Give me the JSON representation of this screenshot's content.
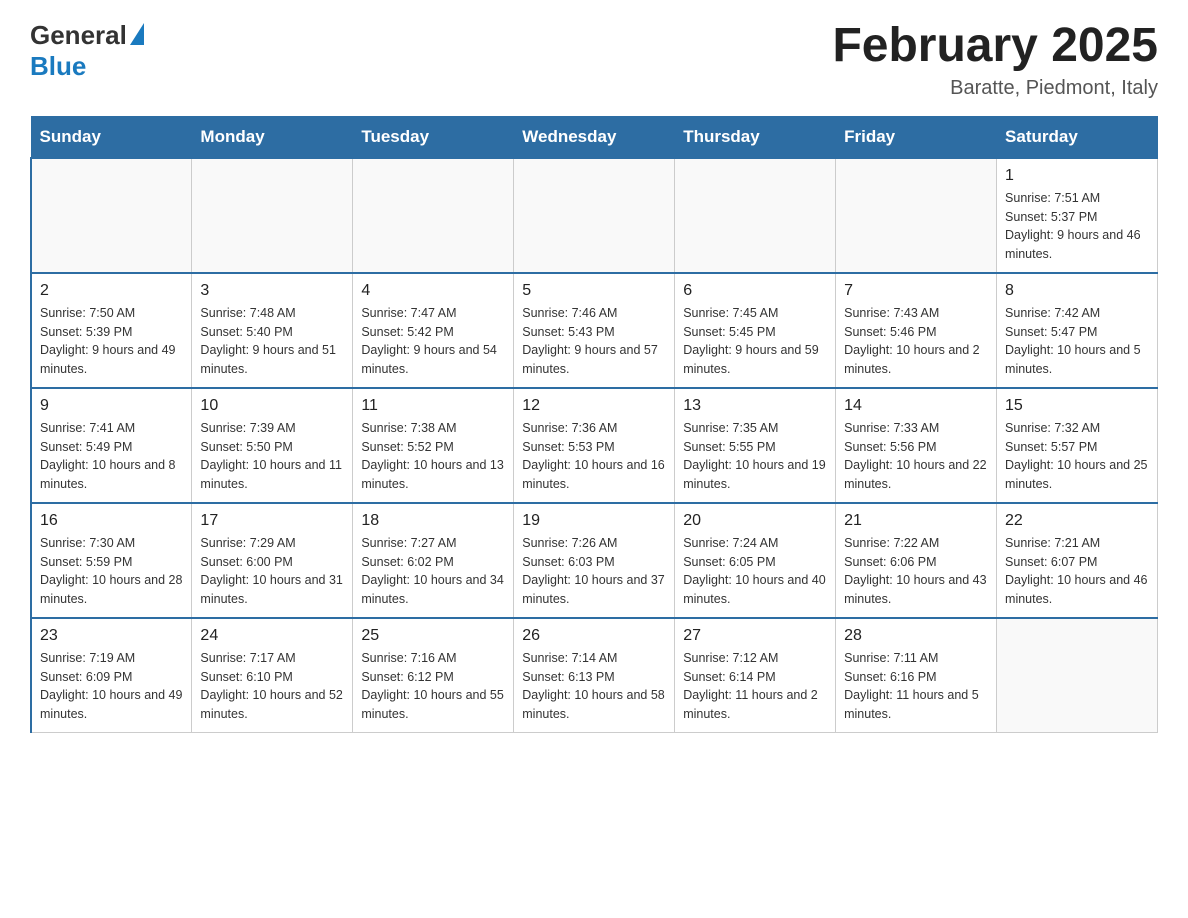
{
  "logo": {
    "general": "General",
    "blue": "Blue"
  },
  "header": {
    "title": "February 2025",
    "location": "Baratte, Piedmont, Italy"
  },
  "weekdays": [
    "Sunday",
    "Monday",
    "Tuesday",
    "Wednesday",
    "Thursday",
    "Friday",
    "Saturday"
  ],
  "weeks": [
    [
      {
        "day": "",
        "info": ""
      },
      {
        "day": "",
        "info": ""
      },
      {
        "day": "",
        "info": ""
      },
      {
        "day": "",
        "info": ""
      },
      {
        "day": "",
        "info": ""
      },
      {
        "day": "",
        "info": ""
      },
      {
        "day": "1",
        "info": "Sunrise: 7:51 AM\nSunset: 5:37 PM\nDaylight: 9 hours and 46 minutes."
      }
    ],
    [
      {
        "day": "2",
        "info": "Sunrise: 7:50 AM\nSunset: 5:39 PM\nDaylight: 9 hours and 49 minutes."
      },
      {
        "day": "3",
        "info": "Sunrise: 7:48 AM\nSunset: 5:40 PM\nDaylight: 9 hours and 51 minutes."
      },
      {
        "day": "4",
        "info": "Sunrise: 7:47 AM\nSunset: 5:42 PM\nDaylight: 9 hours and 54 minutes."
      },
      {
        "day": "5",
        "info": "Sunrise: 7:46 AM\nSunset: 5:43 PM\nDaylight: 9 hours and 57 minutes."
      },
      {
        "day": "6",
        "info": "Sunrise: 7:45 AM\nSunset: 5:45 PM\nDaylight: 9 hours and 59 minutes."
      },
      {
        "day": "7",
        "info": "Sunrise: 7:43 AM\nSunset: 5:46 PM\nDaylight: 10 hours and 2 minutes."
      },
      {
        "day": "8",
        "info": "Sunrise: 7:42 AM\nSunset: 5:47 PM\nDaylight: 10 hours and 5 minutes."
      }
    ],
    [
      {
        "day": "9",
        "info": "Sunrise: 7:41 AM\nSunset: 5:49 PM\nDaylight: 10 hours and 8 minutes."
      },
      {
        "day": "10",
        "info": "Sunrise: 7:39 AM\nSunset: 5:50 PM\nDaylight: 10 hours and 11 minutes."
      },
      {
        "day": "11",
        "info": "Sunrise: 7:38 AM\nSunset: 5:52 PM\nDaylight: 10 hours and 13 minutes."
      },
      {
        "day": "12",
        "info": "Sunrise: 7:36 AM\nSunset: 5:53 PM\nDaylight: 10 hours and 16 minutes."
      },
      {
        "day": "13",
        "info": "Sunrise: 7:35 AM\nSunset: 5:55 PM\nDaylight: 10 hours and 19 minutes."
      },
      {
        "day": "14",
        "info": "Sunrise: 7:33 AM\nSunset: 5:56 PM\nDaylight: 10 hours and 22 minutes."
      },
      {
        "day": "15",
        "info": "Sunrise: 7:32 AM\nSunset: 5:57 PM\nDaylight: 10 hours and 25 minutes."
      }
    ],
    [
      {
        "day": "16",
        "info": "Sunrise: 7:30 AM\nSunset: 5:59 PM\nDaylight: 10 hours and 28 minutes."
      },
      {
        "day": "17",
        "info": "Sunrise: 7:29 AM\nSunset: 6:00 PM\nDaylight: 10 hours and 31 minutes."
      },
      {
        "day": "18",
        "info": "Sunrise: 7:27 AM\nSunset: 6:02 PM\nDaylight: 10 hours and 34 minutes."
      },
      {
        "day": "19",
        "info": "Sunrise: 7:26 AM\nSunset: 6:03 PM\nDaylight: 10 hours and 37 minutes."
      },
      {
        "day": "20",
        "info": "Sunrise: 7:24 AM\nSunset: 6:05 PM\nDaylight: 10 hours and 40 minutes."
      },
      {
        "day": "21",
        "info": "Sunrise: 7:22 AM\nSunset: 6:06 PM\nDaylight: 10 hours and 43 minutes."
      },
      {
        "day": "22",
        "info": "Sunrise: 7:21 AM\nSunset: 6:07 PM\nDaylight: 10 hours and 46 minutes."
      }
    ],
    [
      {
        "day": "23",
        "info": "Sunrise: 7:19 AM\nSunset: 6:09 PM\nDaylight: 10 hours and 49 minutes."
      },
      {
        "day": "24",
        "info": "Sunrise: 7:17 AM\nSunset: 6:10 PM\nDaylight: 10 hours and 52 minutes."
      },
      {
        "day": "25",
        "info": "Sunrise: 7:16 AM\nSunset: 6:12 PM\nDaylight: 10 hours and 55 minutes."
      },
      {
        "day": "26",
        "info": "Sunrise: 7:14 AM\nSunset: 6:13 PM\nDaylight: 10 hours and 58 minutes."
      },
      {
        "day": "27",
        "info": "Sunrise: 7:12 AM\nSunset: 6:14 PM\nDaylight: 11 hours and 2 minutes."
      },
      {
        "day": "28",
        "info": "Sunrise: 7:11 AM\nSunset: 6:16 PM\nDaylight: 11 hours and 5 minutes."
      },
      {
        "day": "",
        "info": ""
      }
    ]
  ]
}
